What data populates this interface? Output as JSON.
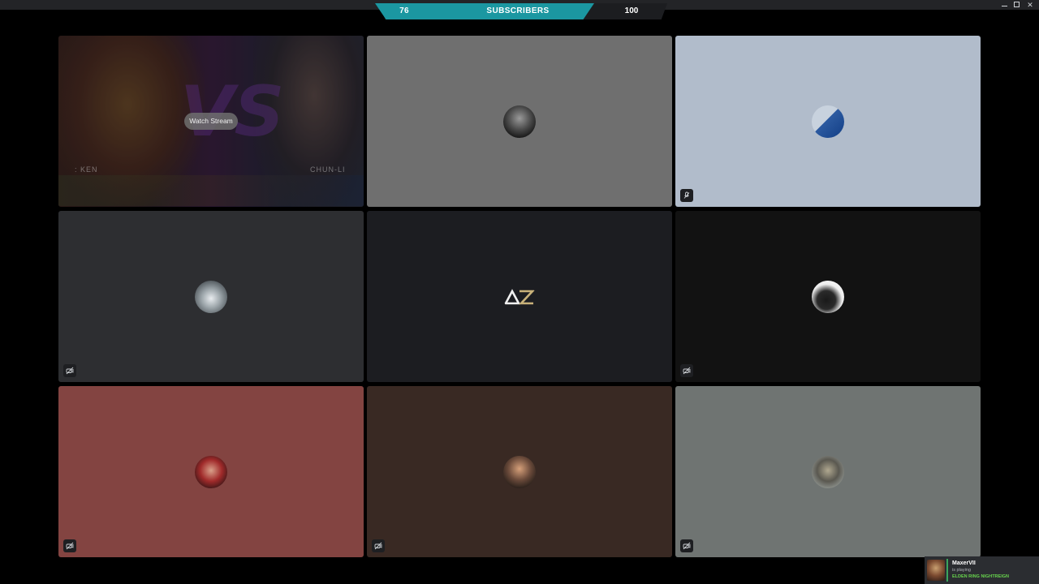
{
  "subscribers": {
    "current": "76",
    "label": "SUBSCRIBERS",
    "goal": "100",
    "progress": 0.76,
    "colors": {
      "fill": "#1b97a1",
      "track": "#1c1d20"
    }
  },
  "tiles": [
    {
      "kind": "stream",
      "background": "#2e2232",
      "watch_label": "Watch Stream",
      "left_name": ": KEN",
      "right_name": "CHUN-LI"
    },
    {
      "kind": "user",
      "background": "#6f6f6f",
      "avatar_icon": "user-avatar-grayscale-icon",
      "status_icon": null
    },
    {
      "kind": "user",
      "background": "#b1bccb",
      "avatar_icon": "user-avatar-blue-icon",
      "status_icon": "mic-off-icon"
    },
    {
      "kind": "user",
      "background": "#2d2e31",
      "avatar_icon": "user-avatar-icon",
      "status_icon": "camera-off-icon"
    },
    {
      "kind": "user",
      "background": "#1c1d21",
      "avatar_text": "AZ",
      "status_icon": null
    },
    {
      "kind": "user",
      "background": "#121212",
      "avatar_icon": "user-avatar-icon",
      "status_icon": "camera-off-icon"
    },
    {
      "kind": "user",
      "background": "#834441",
      "avatar_icon": "user-avatar-icon",
      "status_icon": "camera-off-icon"
    },
    {
      "kind": "user",
      "background": "#392923",
      "avatar_icon": "user-avatar-icon",
      "status_icon": "camera-off-icon"
    },
    {
      "kind": "user",
      "background": "#6f7472",
      "avatar_icon": "user-avatar-icon",
      "status_icon": "camera-off-icon"
    }
  ],
  "activity": {
    "username": "MaxerVII",
    "status": "is playing",
    "game": "ELDEN RING NIGHTREIGN",
    "accent": "#3ba55d"
  }
}
